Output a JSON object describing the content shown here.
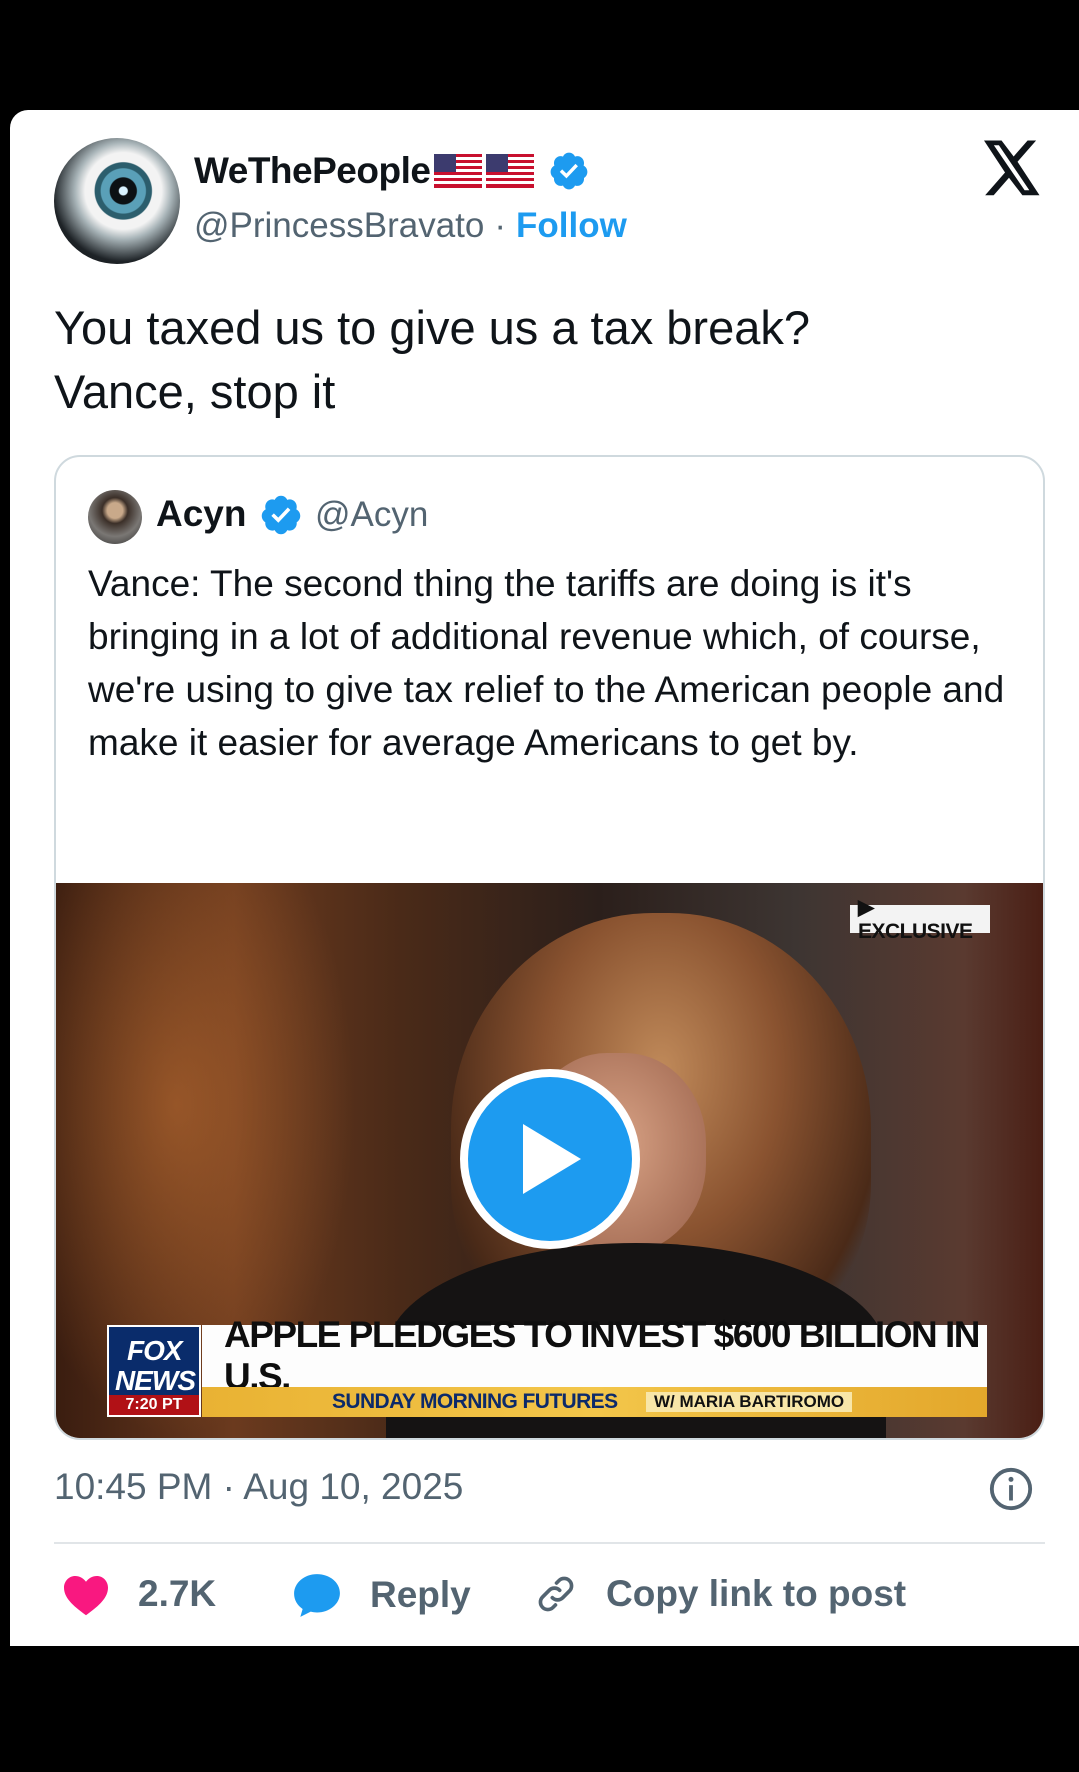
{
  "author": {
    "display_name": "WeThePeople",
    "handle": "@PrincessBravato",
    "separator": "·",
    "follow_label": "Follow"
  },
  "tweet": {
    "text_line1": "You taxed us to give us a tax break?",
    "text_line2": "Vance, stop it",
    "timestamp": "10:45 PM · Aug 10, 2025"
  },
  "quoted": {
    "display_name": "Acyn",
    "handle": "@Acyn",
    "text": "Vance: The second thing the tariffs are doing is it's bringing in a lot of additional revenue which, of course, we're using to give tax relief to the American people and make it easier for average Americans to get by.",
    "video": {
      "exclusive_label": "▶ EXCLUSIVE",
      "logo_top": "FOX",
      "logo_bottom": "NEWS",
      "logo_time": "7:20 PT",
      "headline": "APPLE PLEDGES TO INVEST $600 BILLION IN U.S.",
      "show_name": "SUNDAY MORNING FUTURES",
      "show_host": "W/ MARIA BARTIROMO"
    }
  },
  "actions": {
    "like_count": "2.7K",
    "reply_label": "Reply",
    "copy_label": "Copy link to post"
  },
  "colors": {
    "accent": "#1d9bf0",
    "like": "#f91880",
    "secondary_text": "#536471"
  },
  "icons": [
    "verified-badge-icon",
    "x-logo-icon",
    "play-icon",
    "info-icon",
    "heart-icon",
    "reply-bubble-icon",
    "link-icon",
    "us-flag-icon"
  ]
}
